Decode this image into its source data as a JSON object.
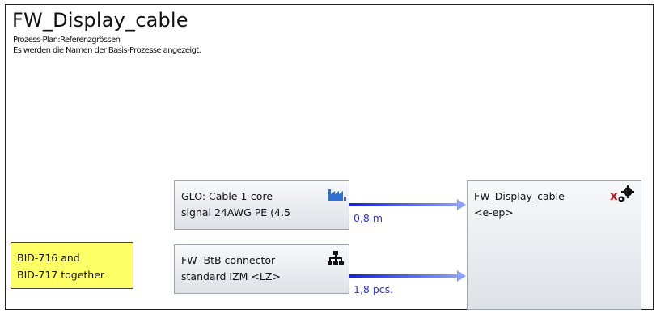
{
  "header": {
    "title": "FW_Display_cable",
    "subtitle1": "Prozess-Plan:Referenzgrössen",
    "subtitle2": "Es werden die Namen der Basis-Prozesse angezeigt."
  },
  "processes": {
    "glo_cable": {
      "line1": "GLO: Cable 1-core",
      "line2": "signal 24AWG PE (4.5",
      "icon": "factory-icon"
    },
    "btb_connector": {
      "line1": "FW- BtB connector",
      "line2": "standard IZM <LZ>",
      "icon": "hierarchy-icon"
    },
    "display_cable": {
      "line1": "FW_Display_cable",
      "line2": "<e-ep>",
      "icon": "x-gears-icon"
    }
  },
  "flows": {
    "cable_amount": "0,8 m",
    "connector_amount": "1,8 pcs."
  },
  "note": {
    "line1": "BID-716 and",
    "line2": "BID-717 together"
  },
  "colors": {
    "flow": "#2a35d8",
    "note_bg": "#ffff66",
    "box_border": "#9da6b0"
  }
}
